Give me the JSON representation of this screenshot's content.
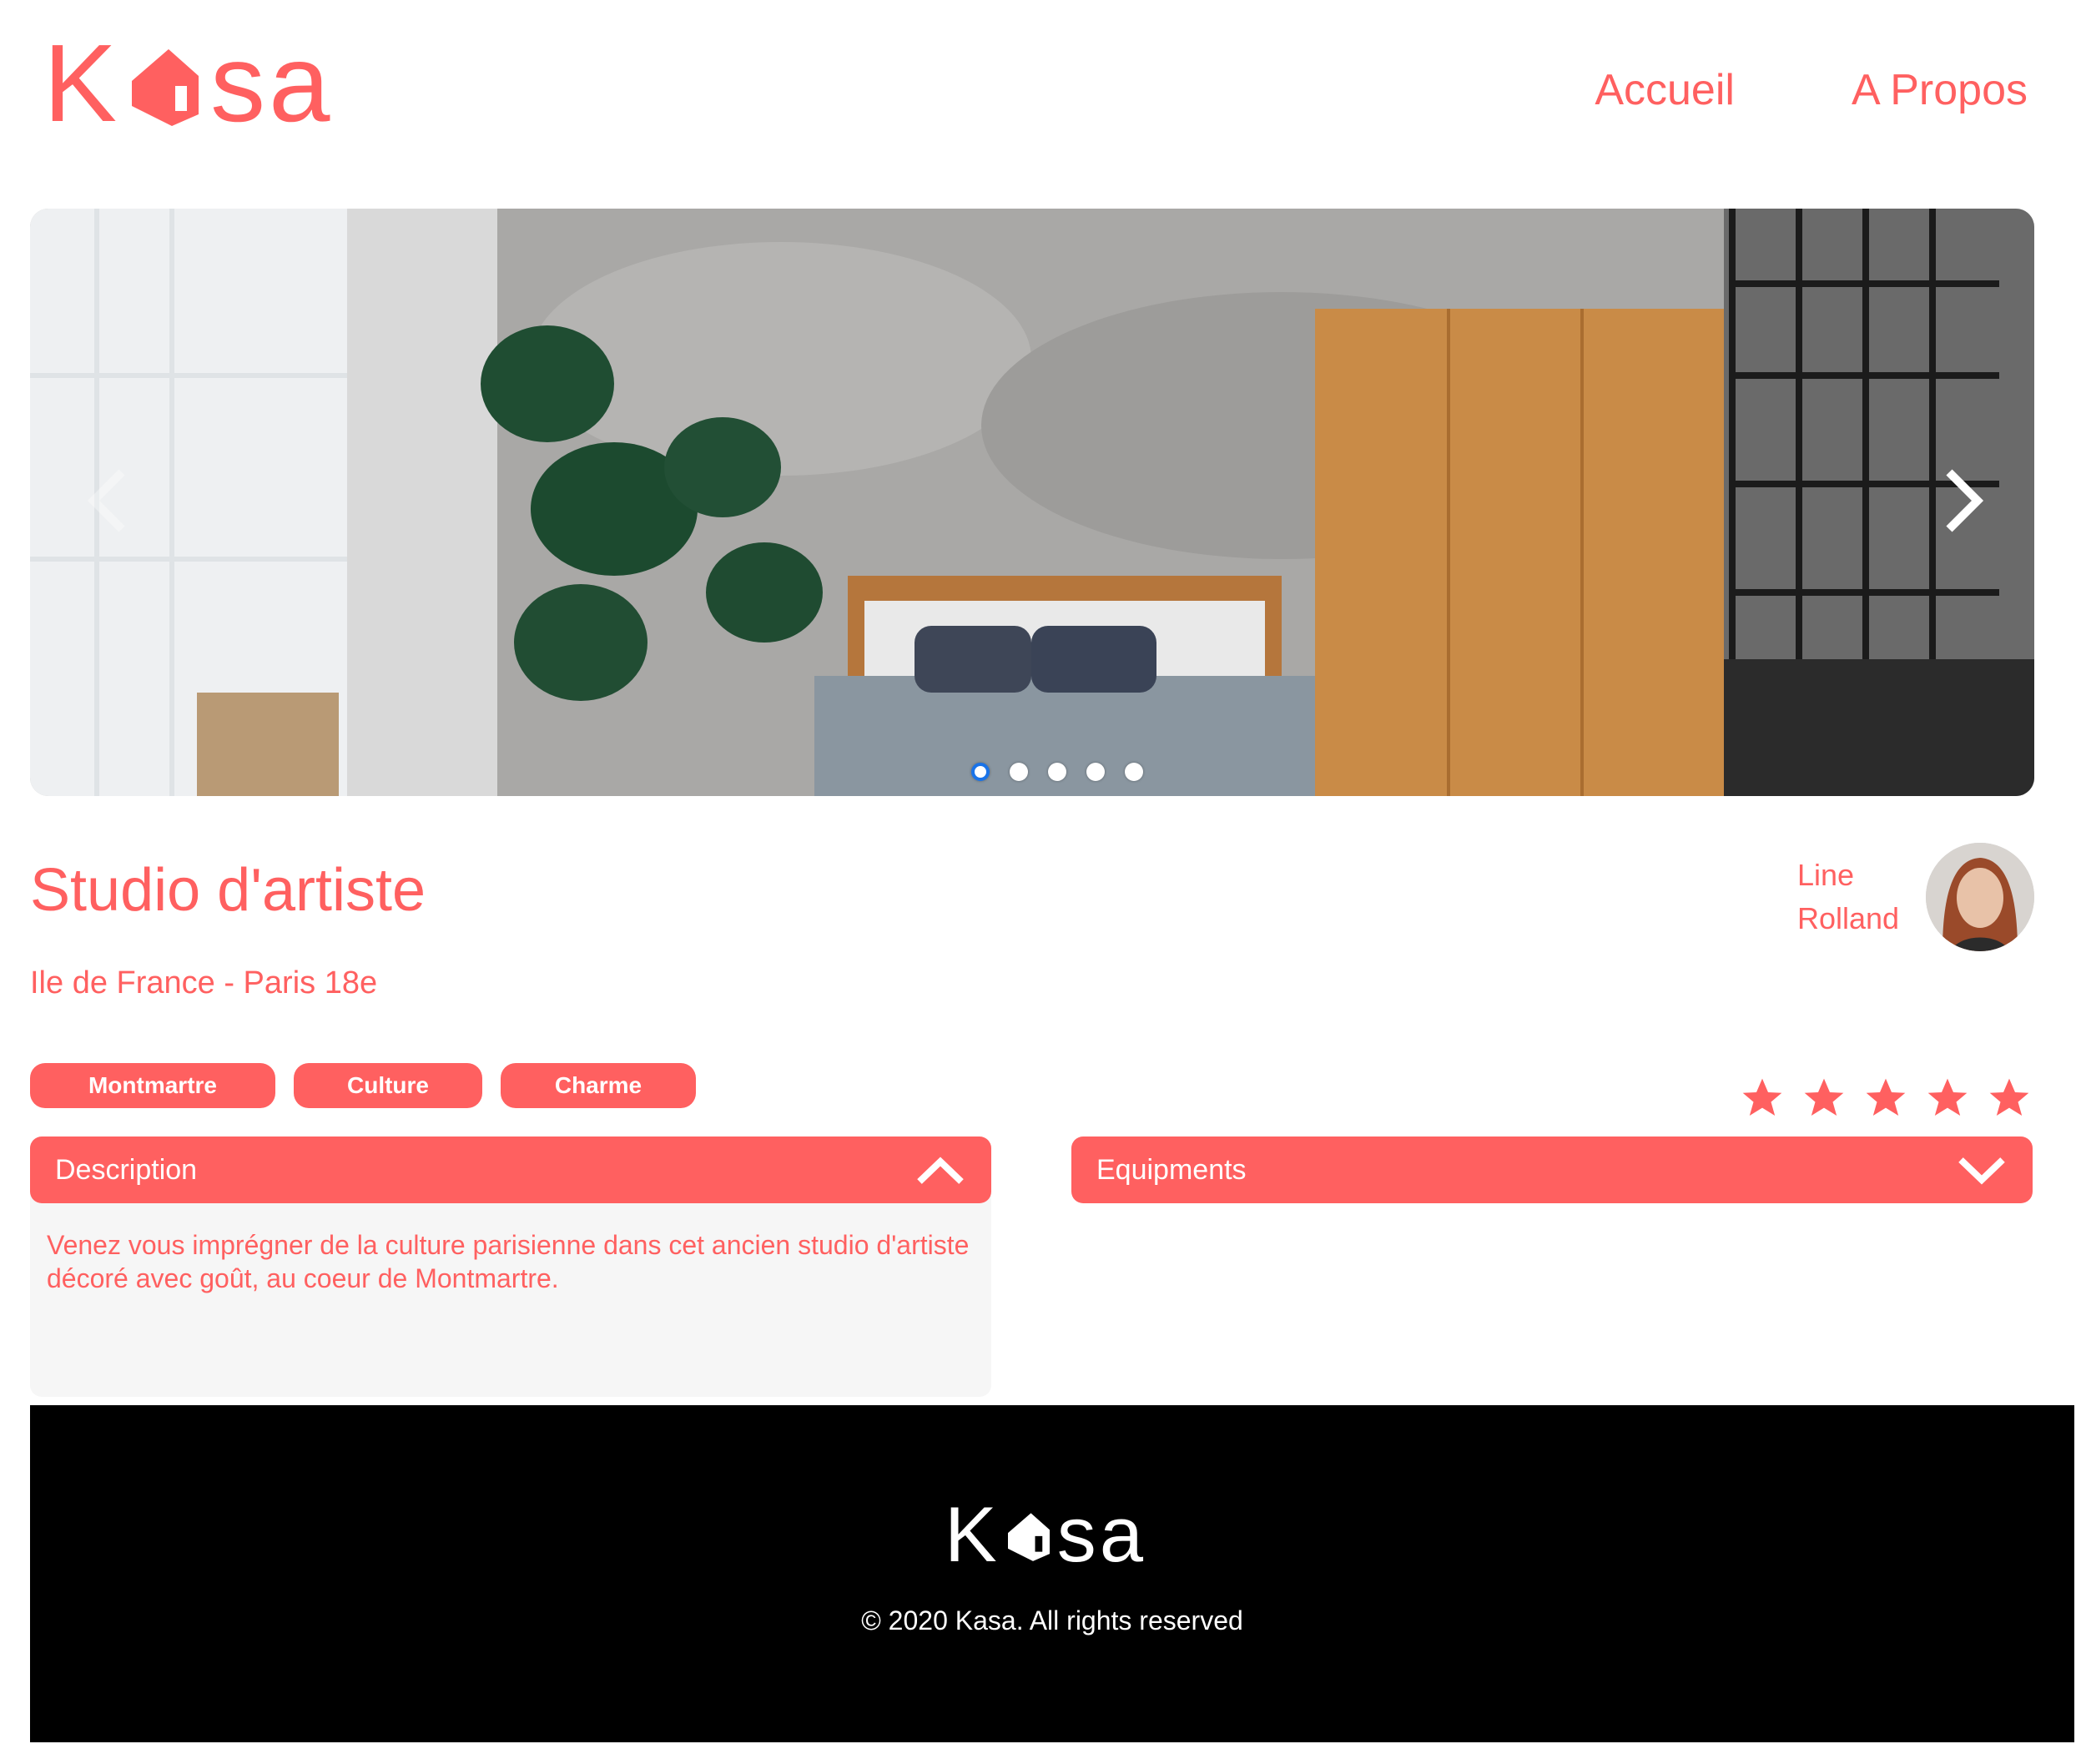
{
  "brand": {
    "logo_left": "K",
    "logo_right": "sa",
    "logo_icon": "house-icon",
    "color": "#FF6060"
  },
  "nav": {
    "home": "Accueil",
    "about": "A Propos"
  },
  "carousel": {
    "prev_icon": "chevron-left-icon",
    "next_icon": "chevron-right-icon",
    "slide_count": 5,
    "active_index": 0
  },
  "listing": {
    "title": "Studio d'artiste",
    "location": "Ile de France - Paris 18e",
    "host": {
      "first": "Line",
      "last": "Rolland"
    },
    "tags": [
      "Montmartre",
      "Culture",
      "Charme"
    ],
    "rating": 5,
    "rating_max": 5
  },
  "collapses": {
    "description": {
      "label": "Description",
      "icon": "chevron-up-icon",
      "text": "Venez vous imprégner de la culture parisienne dans cet ancien studio d'artiste décoré avec goût, au coeur de Montmartre."
    },
    "equipments": {
      "label": "Equipments",
      "icon": "chevron-down-icon"
    }
  },
  "footer": {
    "logo_left": "K",
    "logo_right": "sa",
    "copyright": "© 2020 Kasa. All rights reserved"
  }
}
